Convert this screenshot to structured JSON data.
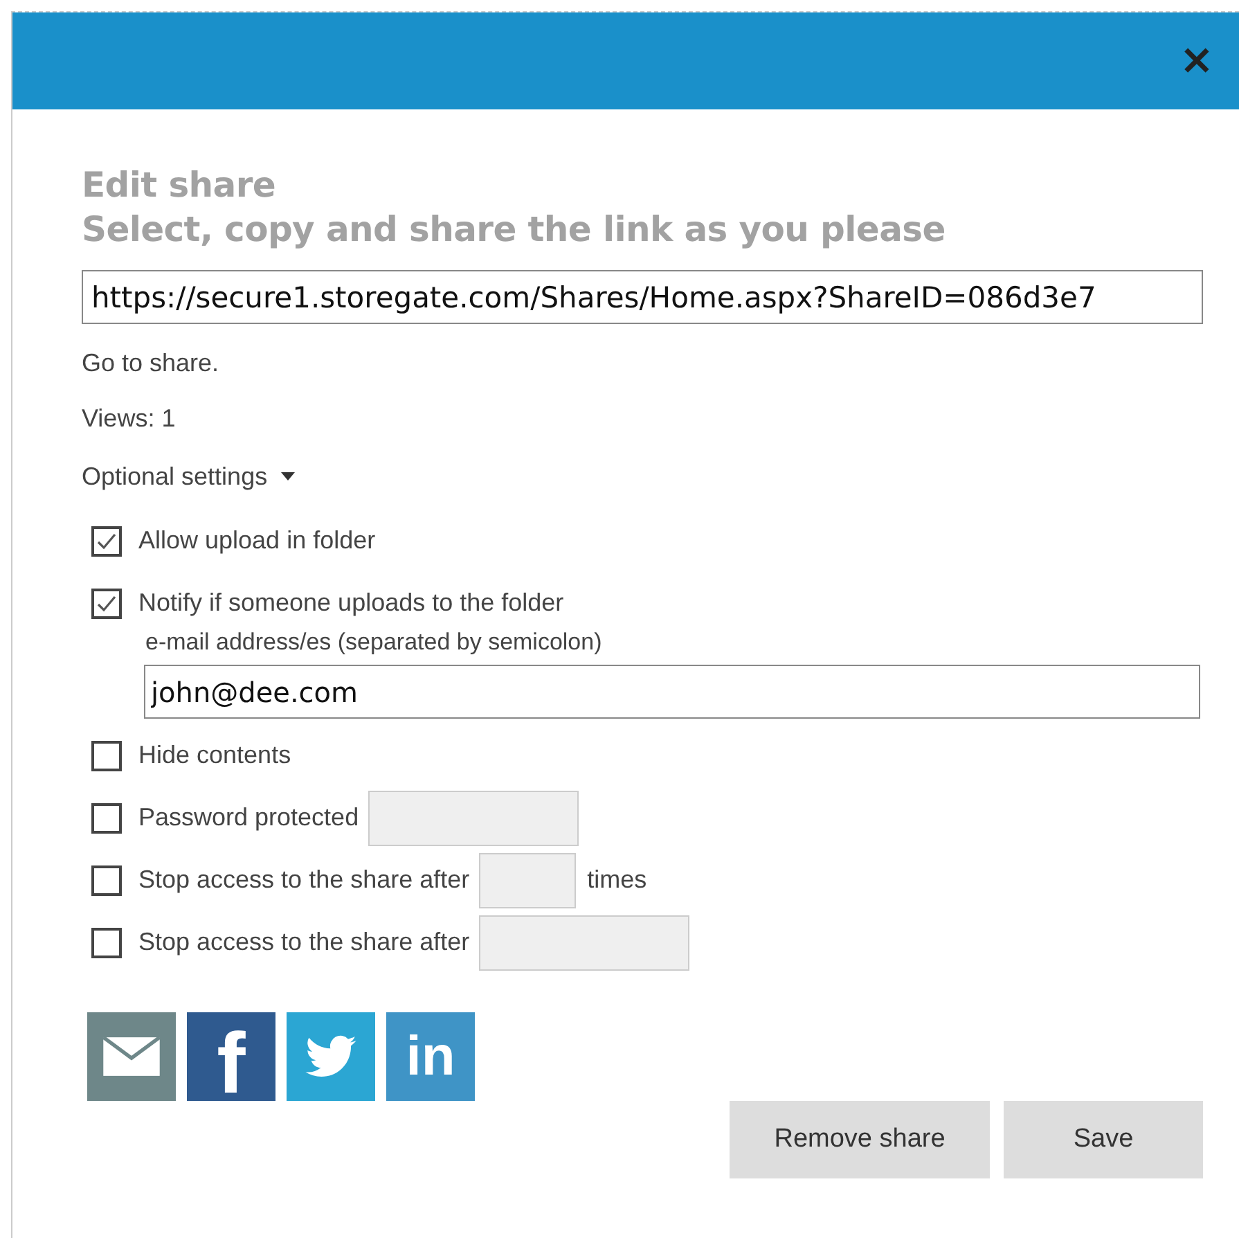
{
  "dialog": {
    "close": "×",
    "title": "Edit share",
    "subtitle": "Select, copy and share the link as you please",
    "link": "https://secure1.storegate.com/Shares/Home.aspx?ShareID=086d3e7",
    "go_to_share": "Go to share.",
    "views": "Views: 1",
    "optional_settings": {
      "label": "Optional settings",
      "expanded": true
    }
  },
  "options": [
    {
      "kind": "plain",
      "label": "Allow upload in folder",
      "checked": true
    },
    {
      "kind": "email",
      "label": "Notify if someone uploads to the folder",
      "checked": true,
      "sublabel": "e-mail address/es (separated by semicolon)",
      "value": "john@dee.com"
    },
    {
      "kind": "plain",
      "label": "Hide contents",
      "checked": false
    },
    {
      "kind": "field",
      "label": "Password protected",
      "checked": false
    },
    {
      "kind": "count",
      "label": "Stop access to the share after",
      "checked": false,
      "suffix": "times"
    },
    {
      "kind": "field",
      "label": "Stop access to the share after",
      "checked": false
    }
  ],
  "social": [
    {
      "kind": "email"
    },
    {
      "kind": "facebook",
      "label": "f"
    },
    {
      "kind": "twitter"
    },
    {
      "kind": "linkedin",
      "label": "in"
    }
  ],
  "buttons": [
    "Remove share",
    "Save"
  ]
}
